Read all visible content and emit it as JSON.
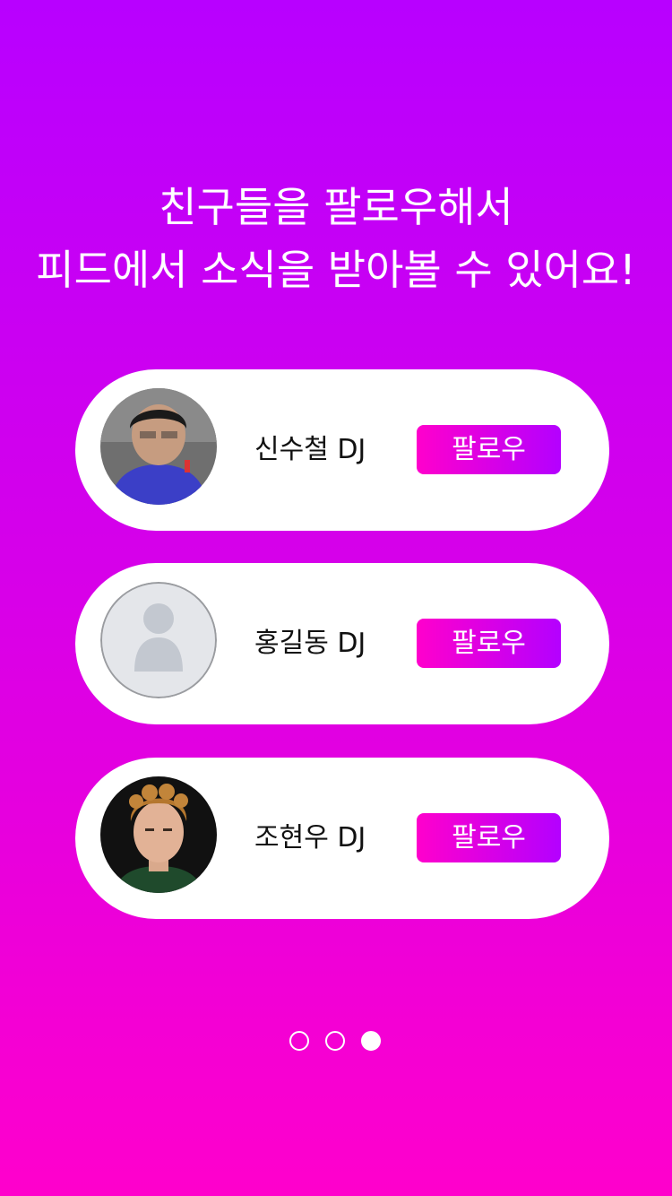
{
  "headline": {
    "line1": "친구들을 팔로우해서",
    "line2": "피드에서 소식을 받아볼 수 있어요!"
  },
  "friends": [
    {
      "name": "신수철 DJ",
      "avatar": "person-photo-blue-shirt",
      "follow_label": "팔로우"
    },
    {
      "name": "홍길동 DJ",
      "avatar": "default-user-icon",
      "follow_label": "팔로우"
    },
    {
      "name": "조현우 DJ",
      "avatar": "person-photo-curly-hair",
      "follow_label": "팔로우"
    }
  ],
  "pager": {
    "total": 3,
    "active_index": 2
  },
  "colors": {
    "background_top": "#b800ff",
    "background_bottom": "#ff00cc",
    "button_gradient_left": "#ff00cc",
    "button_gradient_right": "#b400ff",
    "card": "#ffffff"
  }
}
